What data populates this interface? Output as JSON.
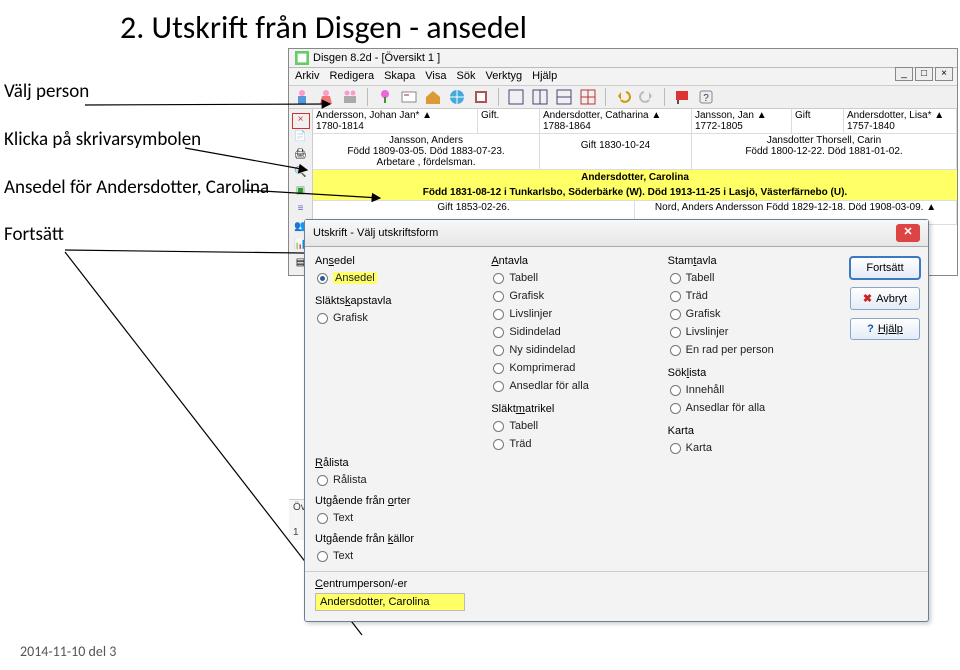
{
  "slide_title": "2. Utskrift från Disgen - ansedel",
  "instructions": {
    "pick_person": "Välj person",
    "click_printer": "Klicka på skrivarsymbolen",
    "ansedel_for": "Ansedel för Andersdotter, Carolina",
    "continue": "Fortsätt"
  },
  "footer": "2014-11-10 del 3",
  "app": {
    "title": "Disgen 8.2d - [Översikt 1 ]",
    "menus": [
      "Arkiv",
      "Redigera",
      "Skapa",
      "Visa",
      "Sök",
      "Verktyg",
      "Hjälp"
    ],
    "win_btns": {
      "min": "_",
      "max": "□",
      "close": "×"
    }
  },
  "grid": {
    "row1": {
      "p1_name": "Andersson, Johan Jan* ▲",
      "p1_years": "1780-1814",
      "p2_rel": "Gift.",
      "p3_name": "Andersdotter, Catharina ▲",
      "p3_years": "1788-1864",
      "p4_name": "Jansson, Jan ▲",
      "p4_years": "1772-1805",
      "p5_rel": "Gift",
      "p6_name": "Andersdotter, Lisa* ▲",
      "p6_years": "1757-1840"
    },
    "row2": {
      "left_name": "Jansson, Anders",
      "left_birth": "Född 1809-03-05. Död 1883-07-23.",
      "left_occ": "Arbetare , fördelsman.",
      "mid": "Gift 1830-10-24",
      "right_name": "Jansdotter Thorsell, Carin",
      "right_birth": "Född 1800-12-22. Död 1881-01-02."
    },
    "row3": {
      "name": "Andersdotter, Carolina",
      "detail": "Född 1831-08-12 i Tunkarlsbo, Söderbärke (W). Död 1913-11-25 i Lasjö, Västerfärnebo (U)."
    },
    "row4": {
      "left": "Gift 1853-02-26.",
      "right": "Nord, Anders Andersson Född 1829-12-18. Död 1908-03-09. ▲"
    },
    "trunc_left": "Öve",
    "trunc_num": "1"
  },
  "dialog": {
    "title": "Utskrift - Välj utskriftsform",
    "cols": {
      "col1": {
        "g1": {
          "heading": "Ansedel",
          "items": [
            {
              "label": "Ansedel",
              "selected": true,
              "highlight": true
            }
          ]
        },
        "g2": {
          "heading": "Släktskapstavla",
          "items": [
            {
              "label": "Grafisk"
            }
          ]
        },
        "g3": {
          "heading": "Rålista",
          "items": [
            {
              "label": "Rålista"
            }
          ]
        },
        "g4": {
          "heading": "Utgående från orter",
          "items": [
            {
              "label": "Text"
            }
          ]
        },
        "g5": {
          "heading": "Utgående från källor",
          "items": [
            {
              "label": "Text"
            }
          ]
        }
      },
      "col2": {
        "g1": {
          "heading": "Antavla",
          "items": [
            {
              "label": "Tabell"
            },
            {
              "label": "Grafisk"
            },
            {
              "label": "Livslinjer"
            },
            {
              "label": "Sidindelad"
            },
            {
              "label": "Ny sidindelad"
            },
            {
              "label": "Komprimerad"
            },
            {
              "label": "Ansedlar för alla"
            }
          ]
        },
        "g2": {
          "heading": "Släktmatrikel",
          "items": [
            {
              "label": "Tabell"
            },
            {
              "label": "Träd"
            }
          ]
        }
      },
      "col3": {
        "g1": {
          "heading": "Stamtavla",
          "items": [
            {
              "label": "Tabell"
            },
            {
              "label": "Träd"
            },
            {
              "label": "Grafisk"
            },
            {
              "label": "Livslinjer"
            },
            {
              "label": "En rad per person"
            }
          ]
        },
        "g2": {
          "heading": "Söklista",
          "items": [
            {
              "label": "Innehåll"
            },
            {
              "label": "Ansedlar för alla"
            }
          ]
        },
        "g3": {
          "heading": "Karta",
          "items": [
            {
              "label": "Karta"
            }
          ]
        }
      }
    },
    "buttons": {
      "continue": "Fortsätt",
      "cancel": "Avbryt",
      "help": "Hjälp"
    },
    "centrum_label": "Centrumperson/-er",
    "centrum_value": "Andersdotter, Carolina"
  }
}
